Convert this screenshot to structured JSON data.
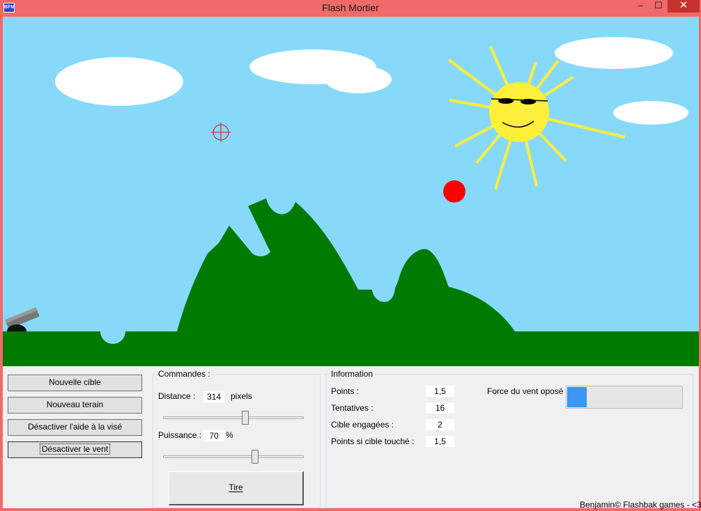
{
  "window": {
    "title": "Flash Mortier",
    "icon_text": "BFM",
    "minimize_icon": "minimize-icon",
    "maximize_icon": "maximize-icon",
    "close_icon": "close-icon",
    "minimize_glyph": "–",
    "maximize_glyph": "☐",
    "close_glyph": "✕"
  },
  "buttons": {
    "new_target": "Nouvelle cible",
    "new_terrain": "Nouveau terain",
    "toggle_aim": "Désactiver l'aide à la visé",
    "toggle_wind": "Désactiver le vent"
  },
  "commands": {
    "title": "Commandes :",
    "distance_label": "Distance :",
    "distance_value": "314",
    "distance_unit": "pixels",
    "distance_slider_fraction": 0.59,
    "power_label": "Puissance :",
    "power_value": "70",
    "power_unit": "%",
    "power_slider_fraction": 0.66,
    "fire_label": "Tire"
  },
  "information": {
    "title": "Information",
    "rows": [
      {
        "label": "Points :",
        "value": "1,5"
      },
      {
        "label": "Tentatives :",
        "value": "16"
      },
      {
        "label": "Cible engagées :",
        "value": "2"
      },
      {
        "label": "Points si cible touché :",
        "value": "1,5"
      }
    ],
    "wind_label": "Force du vent oposé :",
    "wind_level": 0.17
  },
  "footer": "Benjamin© Flashbak games - <3",
  "colors": {
    "sky": "#87d9fa",
    "ground": "#007a00",
    "sun": "#ffee3a",
    "ball": "#ff0000",
    "titlebar": "#f06a6a",
    "wind_fill": "#3b97f2"
  },
  "scene_icons": [
    "cannon-icon",
    "crosshair-icon",
    "sun-icon",
    "cloud-icon",
    "ball-icon"
  ]
}
